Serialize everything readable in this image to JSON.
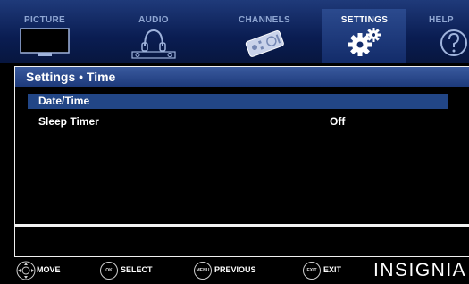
{
  "menu": {
    "tabs": [
      {
        "label": "PICTURE",
        "icon": "tv-icon"
      },
      {
        "label": "AUDIO",
        "icon": "headphones-icon"
      },
      {
        "label": "CHANNELS",
        "icon": "remote-control-icon"
      },
      {
        "label": "SETTINGS",
        "icon": "gears-icon",
        "active": true
      },
      {
        "label": "HELP",
        "icon": "question-mark-icon"
      }
    ]
  },
  "panel": {
    "title": "Settings • Time",
    "rows": [
      {
        "label": "Date/Time",
        "value": "",
        "selected": true
      },
      {
        "label": "Sleep Timer",
        "value": "Off",
        "selected": false
      }
    ]
  },
  "legend": {
    "move": {
      "label": "MOVE"
    },
    "select": {
      "label": "SELECT",
      "button_text": "OK"
    },
    "previous": {
      "label": "PREVIOUS",
      "button_text": "MENU"
    },
    "exit": {
      "label": "EXIT",
      "button_text": "EXIT"
    },
    "brand": "INSIGNIA"
  },
  "colors": {
    "menu_bar": "#0a1d52",
    "selected_row": "#224686",
    "title_bar": "#2b4b8e"
  }
}
